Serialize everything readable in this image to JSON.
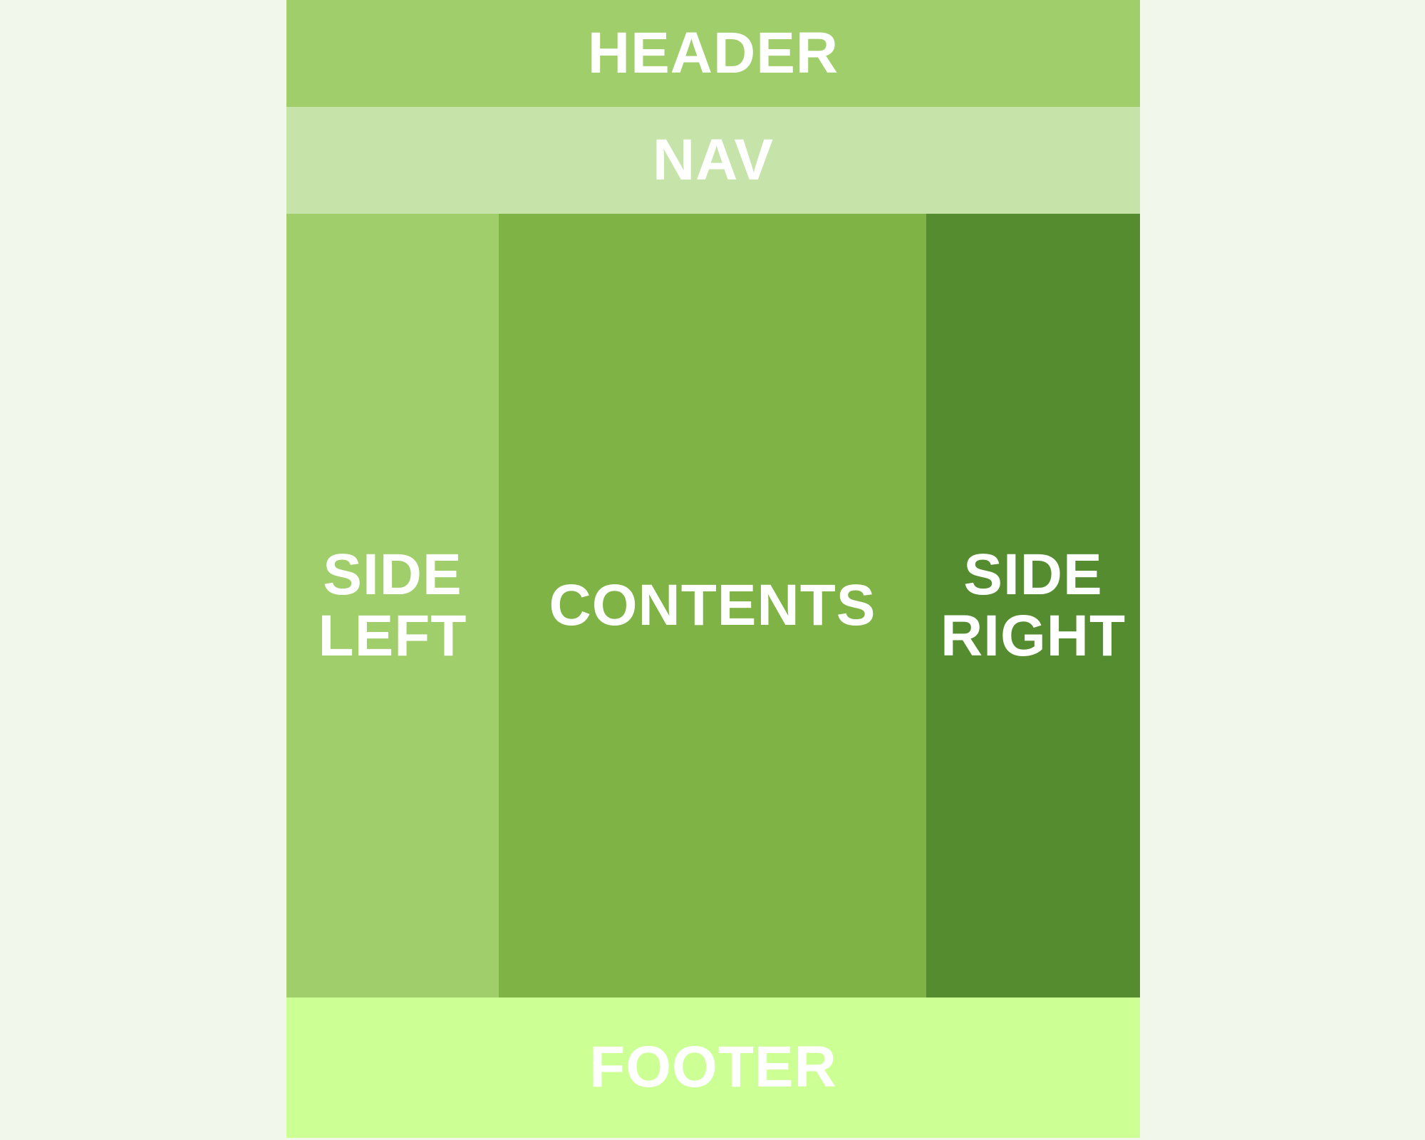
{
  "colors": {
    "background": "#f1f7ea",
    "header": "#9fce6a",
    "nav": "#c6e3a9",
    "side_left": "#9fce6a",
    "contents": "#7fb345",
    "side_right": "#548c2f",
    "footer": "#ccff94",
    "text": "#ffffff"
  },
  "layout": {
    "header": {
      "label": "HEADER"
    },
    "nav": {
      "label": "NAV"
    },
    "side_left": {
      "line1": "SIDE",
      "line2": "LEFT"
    },
    "contents": {
      "label": "CONTENTS"
    },
    "side_right": {
      "line1": "SIDE",
      "line2": "RIGHT"
    },
    "footer": {
      "label": "FOOTER"
    }
  }
}
